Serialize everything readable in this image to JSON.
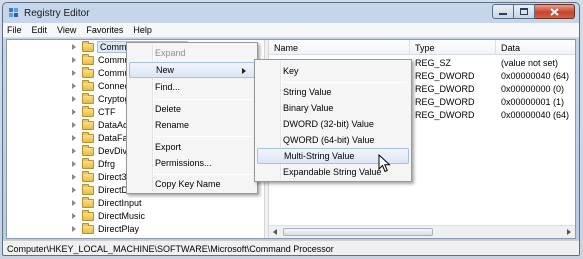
{
  "window": {
    "title": "Registry Editor",
    "controls": {
      "minimize": "minimize-icon",
      "maximize": "maximize-icon",
      "close": "close-icon"
    }
  },
  "menubar": {
    "items": [
      "File",
      "Edit",
      "View",
      "Favorites",
      "Help"
    ]
  },
  "tree": {
    "items": [
      {
        "label": "Command Processor",
        "selected": true
      },
      {
        "label": "Commun"
      },
      {
        "label": "Commun"
      },
      {
        "label": "Connect t"
      },
      {
        "label": "Cryptogra"
      },
      {
        "label": "CTF"
      },
      {
        "label": "DataAcces"
      },
      {
        "label": "DataFacto"
      },
      {
        "label": "DevDiv"
      },
      {
        "label": "Dfrg"
      },
      {
        "label": "Direct3D"
      },
      {
        "label": "DirectDrav"
      },
      {
        "label": "DirectInput"
      },
      {
        "label": "DirectMusic"
      },
      {
        "label": "DirectPlay"
      }
    ]
  },
  "list": {
    "columns": [
      "Name",
      "Type",
      "Data"
    ],
    "rows": [
      {
        "name": "",
        "type": "REG_SZ",
        "data": "(value not set)"
      },
      {
        "name": "",
        "type": "REG_DWORD",
        "data": "0x00000040 (64)"
      },
      {
        "name": "",
        "type": "REG_DWORD",
        "data": "0x00000000 (0)"
      },
      {
        "name": "",
        "type": "REG_DWORD",
        "data": "0x00000001 (1)"
      },
      {
        "name": "",
        "type": "REG_DWORD",
        "data": "0x00000040 (64)"
      }
    ]
  },
  "context_menu": {
    "items": [
      {
        "label": "Expand",
        "disabled": true
      },
      {
        "label": "New",
        "submenu": true,
        "hover": true
      },
      {
        "label": "Find..."
      },
      {
        "separator": true
      },
      {
        "label": "Delete"
      },
      {
        "label": "Rename"
      },
      {
        "separator": true
      },
      {
        "label": "Export"
      },
      {
        "label": "Permissions..."
      },
      {
        "separator": true
      },
      {
        "label": "Copy Key Name"
      }
    ]
  },
  "submenu": {
    "items": [
      {
        "label": "Key"
      },
      {
        "separator": true
      },
      {
        "label": "String Value"
      },
      {
        "label": "Binary Value"
      },
      {
        "label": "DWORD (32-bit) Value"
      },
      {
        "label": "QWORD (64-bit) Value"
      },
      {
        "label": "Multi-String Value",
        "hover": true
      },
      {
        "label": "Expandable String Value"
      }
    ]
  },
  "statusbar": {
    "path": "Computer\\HKEY_LOCAL_MACHINE\\SOFTWARE\\Microsoft\\Command Processor"
  },
  "colors": {
    "selection_bg": "#dde8f6",
    "menu_hover": "#dbe6f4",
    "close_button": "#c4452e",
    "folder": "#e7bd45"
  }
}
